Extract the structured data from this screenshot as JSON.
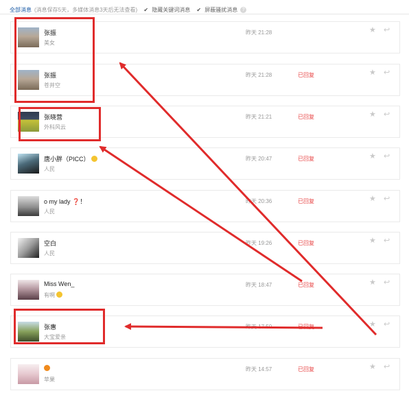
{
  "topbar": {
    "all_label": "全部消息",
    "note": "(消息保存5天，多媒体消息3天后无法查看)",
    "filter_keywords": "隐藏关键词消息",
    "filter_spam": "屏蔽骚扰消息",
    "check_glyph": "✔",
    "help_glyph": "?"
  },
  "messages": [
    {
      "name": "张振",
      "sub": "美女",
      "time": "昨天 21:28",
      "status": "",
      "avatar": "city",
      "emoji": ""
    },
    {
      "name": "张振",
      "sub": "苍井空",
      "time": "昨天 21:28",
      "status": "已回复",
      "avatar": "city",
      "emoji": ""
    },
    {
      "name": "张晓营",
      "sub": "外科风云",
      "time": "昨天 21:21",
      "status": "已回复",
      "avatar": "book",
      "emoji": ""
    },
    {
      "name": "唐小胖（PICC）",
      "sub": "人民",
      "time": "昨天 20:47",
      "status": "已回复",
      "avatar": "suit",
      "emoji": "smile"
    },
    {
      "name": "o my lady",
      "sub": "人民",
      "time": "昨天 20:36",
      "status": "已回复",
      "avatar": "gray",
      "emoji": "",
      "suffix": "！"
    },
    {
      "name": "空白",
      "sub": "人民",
      "time": "昨天 19:26",
      "status": "已回复",
      "avatar": "bw",
      "emoji": ""
    },
    {
      "name": "Miss Wen_",
      "sub": "有啊",
      "time": "昨天 18:47",
      "status": "已回复",
      "avatar": "girl",
      "emoji": "smile-sub"
    },
    {
      "name": "张惠",
      "sub": "大宝爱亲",
      "time": "昨天 17:50",
      "status": "已回复",
      "avatar": "field",
      "emoji": ""
    },
    {
      "name": "",
      "sub": "苹果",
      "time": "昨天 14:57",
      "status": "已回复",
      "avatar": "pink",
      "emoji": "pumpkin"
    }
  ],
  "icons": {
    "star": "★",
    "reply": "↩",
    "question_mark": "❓"
  },
  "colors": {
    "annotation_red": "#e02b2b",
    "replied_red": "#e84a4a",
    "link_blue": "#1a5aa6"
  }
}
